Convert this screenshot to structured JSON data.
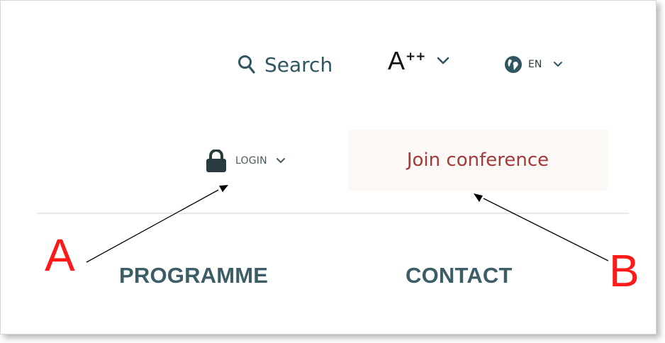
{
  "header": {
    "search_label": "Search",
    "fontsize_label": "A",
    "fontsize_sup": "++",
    "language_label": "EN"
  },
  "account": {
    "login_label": "LOGIN",
    "join_label": "Join conference"
  },
  "nav": {
    "items": [
      {
        "label": "PROGRAMME"
      },
      {
        "label": "CONTACT"
      }
    ]
  },
  "annotations": {
    "a_label": "A",
    "b_label": "B",
    "color": "#ff1a1a"
  },
  "colors": {
    "accent_teal": "#2f5560",
    "join_text": "#a23a3a"
  }
}
